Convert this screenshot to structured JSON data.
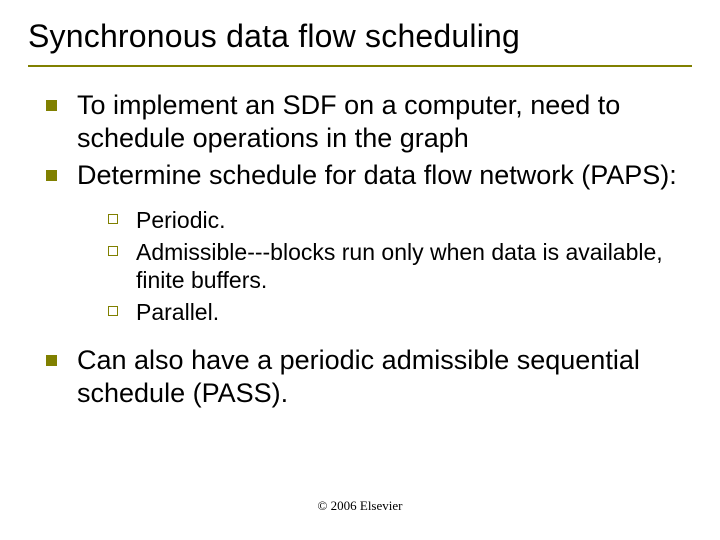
{
  "title": "Synchronous data flow scheduling",
  "bullets": {
    "b1": "To implement an SDF on a computer, need to schedule operations in the graph",
    "b2": "Determine schedule for data flow network (PAPS):",
    "b2_sub": {
      "s1": "Periodic.",
      "s2": "Admissible---blocks run only when data is available, finite buffers.",
      "s3": "Parallel."
    },
    "b3": "Can also have a periodic admissible sequential schedule (PASS)."
  },
  "footer": "© 2006 Elsevier"
}
